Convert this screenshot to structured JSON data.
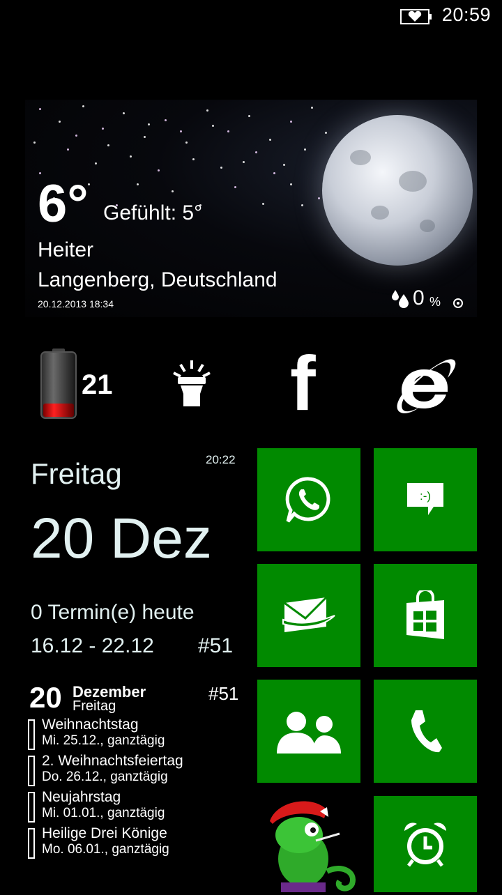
{
  "status_bar": {
    "time": "20:59",
    "battery_icon": "battery-heart-icon"
  },
  "weather": {
    "temperature": "6°",
    "feels_like": "Gefühlt: 5°",
    "condition": "Heiter",
    "location": "Langenberg, Deutschland",
    "updated": "20.12.2013 18:34",
    "precip_value": "0",
    "precip_unit": "%",
    "background_icon": "moon-night-image"
  },
  "quick_row": {
    "battery_level": "21",
    "battery_fill_fraction": 0.21,
    "flashlight_icon": "flashlight-icon",
    "facebook_glyph": "f",
    "browser_icon": "internet-explorer-icon"
  },
  "calendar": {
    "weekday": "Freitag",
    "time": "20:22",
    "date": "20 Dez",
    "appointments": "0 Termin(e) heute",
    "week_range": "16.12 - 22.12",
    "week_number": "#51"
  },
  "holidays": {
    "day_number": "20",
    "month": "Dezember",
    "weekday": "Freitag",
    "week_number": "#51",
    "items": [
      {
        "name": "Weihnachtstag",
        "date": "Mi. 25.12., ganztägig"
      },
      {
        "name": "2. Weihnachtsfeiertag",
        "date": "Do. 26.12., ganztägig"
      },
      {
        "name": "Neujahrstag",
        "date": "Mi. 01.01., ganztägig"
      },
      {
        "name": "Heilige Drei Könige",
        "date": "Mo. 06.01., ganztägig"
      }
    ]
  },
  "tiles": {
    "accent_color": "#018a00",
    "items": [
      "whatsapp-icon",
      "messaging-icon",
      "mail-icon",
      "store-icon",
      "people-icon",
      "phone-icon",
      "mascot-image",
      "alarm-icon"
    ]
  },
  "colors": {
    "background": "#000000",
    "calendar_text": "#e2f1f1",
    "battery_red": "#e01010"
  }
}
